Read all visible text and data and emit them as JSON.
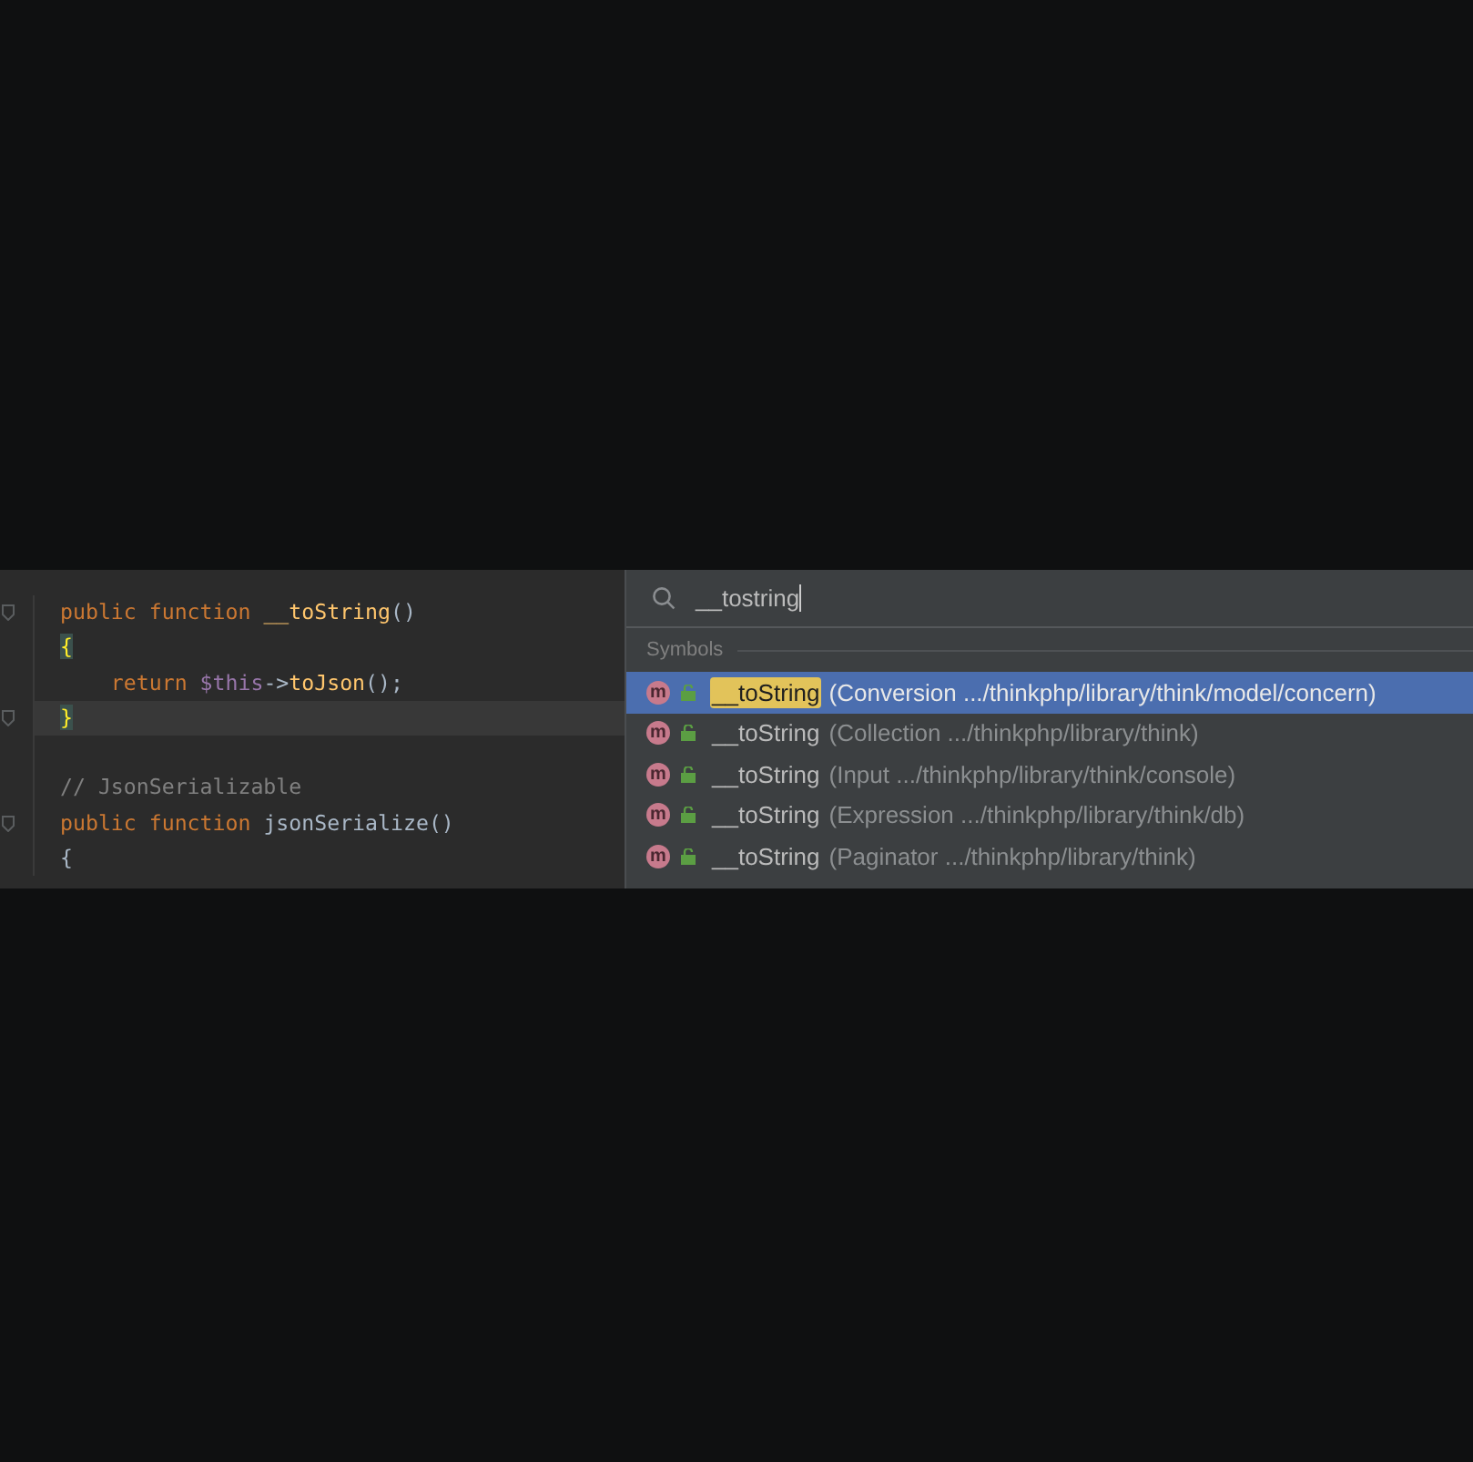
{
  "editor": {
    "lines": [
      {
        "current": false,
        "fold": true,
        "tokens": [
          {
            "text": "public function ",
            "kind": "keyword"
          },
          {
            "text": "__toString",
            "kind": "name"
          },
          {
            "text": "()",
            "kind": "plain"
          }
        ]
      },
      {
        "current": false,
        "fold": false,
        "tokens": [
          {
            "text": "{",
            "kind": "brace"
          }
        ]
      },
      {
        "current": false,
        "fold": false,
        "tokens": [
          {
            "text": "    return ",
            "kind": "keyword"
          },
          {
            "text": "$this",
            "kind": "var"
          },
          {
            "text": "->",
            "kind": "plain"
          },
          {
            "text": "toJson",
            "kind": "name"
          },
          {
            "text": "();",
            "kind": "plain"
          }
        ]
      },
      {
        "current": true,
        "fold": true,
        "tokens": [
          {
            "text": "}",
            "kind": "brace"
          }
        ]
      },
      {
        "current": false,
        "fold": false
      },
      {
        "current": false,
        "fold": false,
        "tokens": [
          {
            "text": "// JsonSerializable",
            "kind": "comment"
          }
        ]
      },
      {
        "current": false,
        "fold": true,
        "tokens": [
          {
            "text": "public function ",
            "kind": "keyword"
          },
          {
            "text": "jsonSerialize",
            "kind": "plain"
          },
          {
            "text": "()",
            "kind": "plain"
          }
        ]
      },
      {
        "current": false,
        "fold": false,
        "tokens": [
          {
            "text": "{",
            "kind": "plain"
          }
        ]
      }
    ]
  },
  "popup": {
    "search": {
      "value": "__tostring"
    },
    "section": "Symbols",
    "results": [
      {
        "badge": "m",
        "name": "__toString",
        "detail": "(Conversion .../thinkphp/library/think/model/concern)",
        "selected": true
      },
      {
        "badge": "m",
        "name": "__toString",
        "detail": "(Collection .../thinkphp/library/think)",
        "selected": false
      },
      {
        "badge": "m",
        "name": "__toString",
        "detail": "(Input .../thinkphp/library/think/console)",
        "selected": false
      },
      {
        "badge": "m",
        "name": "__toString",
        "detail": "(Expression .../thinkphp/library/think/db)",
        "selected": false
      },
      {
        "badge": "m",
        "name": "__toString",
        "detail": "(Paginator .../thinkphp/library/think)",
        "selected": false
      }
    ]
  }
}
